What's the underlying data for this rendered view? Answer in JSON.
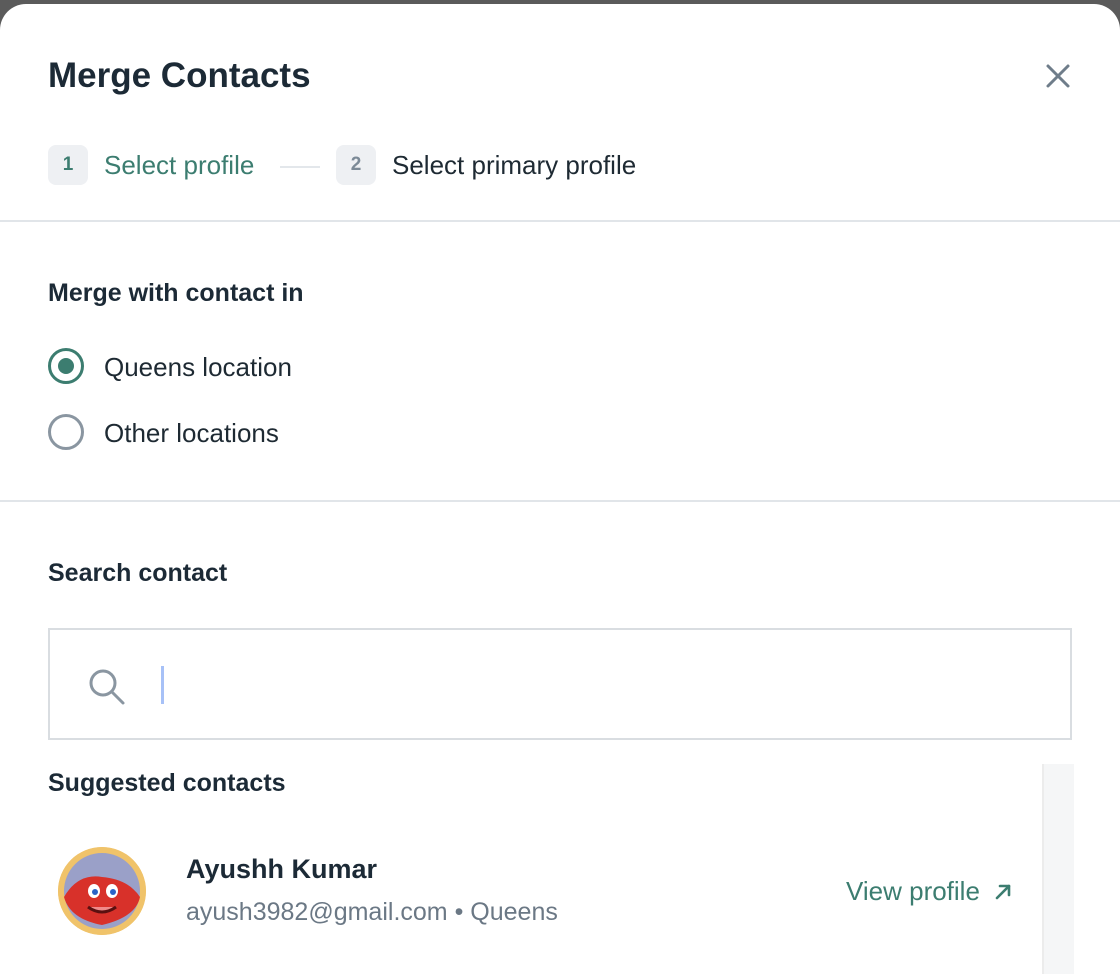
{
  "modal": {
    "title": "Merge Contacts",
    "close_icon": "close-icon"
  },
  "steps": [
    {
      "number": "1",
      "label": "Select profile",
      "state": "active"
    },
    {
      "number": "2",
      "label": "Select primary profile",
      "state": "inactive"
    }
  ],
  "merge_with": {
    "title": "Merge with contact in",
    "options": [
      {
        "label": "Queens location",
        "checked": true
      },
      {
        "label": "Other locations",
        "checked": false
      }
    ]
  },
  "search": {
    "title": "Search contact",
    "value": "",
    "icon": "search-icon"
  },
  "suggested": {
    "title": "Suggested contacts",
    "contacts": [
      {
        "name": "Ayushh Kumar",
        "email": "ayush3982@gmail.com",
        "separator": "•",
        "location": "Queens",
        "action_label": "View profile",
        "action_icon": "arrow-up-right-icon"
      }
    ]
  },
  "colors": {
    "accent": "#3c7d70",
    "text": "#1c2a36",
    "muted": "#6b7885",
    "divider": "#e1e5e9"
  }
}
